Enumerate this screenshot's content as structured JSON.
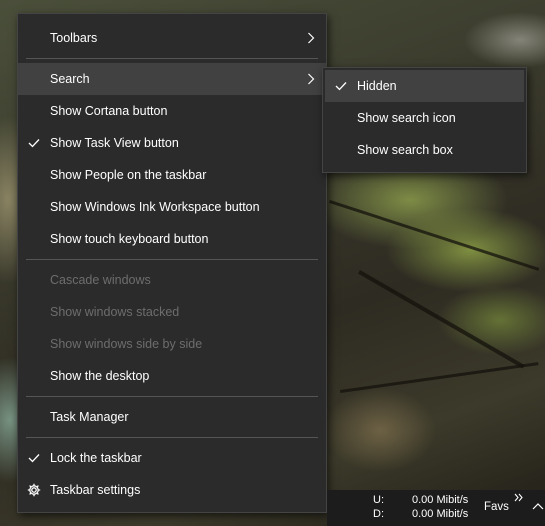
{
  "context_menu": {
    "items": [
      {
        "label": "Toolbars",
        "checked": false,
        "enabled": true,
        "has_submenu": true
      },
      {
        "label": "Search",
        "checked": false,
        "enabled": true,
        "has_submenu": true,
        "highlighted": true
      },
      {
        "label": "Show Cortana button",
        "checked": false,
        "enabled": true
      },
      {
        "label": "Show Task View button",
        "checked": true,
        "enabled": true
      },
      {
        "label": "Show People on the taskbar",
        "checked": false,
        "enabled": true
      },
      {
        "label": "Show Windows Ink Workspace button",
        "checked": false,
        "enabled": true
      },
      {
        "label": "Show touch keyboard button",
        "checked": false,
        "enabled": true
      },
      {
        "label": "Cascade windows",
        "checked": false,
        "enabled": false
      },
      {
        "label": "Show windows stacked",
        "checked": false,
        "enabled": false
      },
      {
        "label": "Show windows side by side",
        "checked": false,
        "enabled": false
      },
      {
        "label": "Show the desktop",
        "checked": false,
        "enabled": true
      },
      {
        "label": "Task Manager",
        "checked": false,
        "enabled": true
      },
      {
        "label": "Lock the taskbar",
        "checked": true,
        "enabled": true
      },
      {
        "label": "Taskbar settings",
        "checked": false,
        "enabled": true,
        "icon": "gear-icon"
      }
    ]
  },
  "search_submenu": {
    "items": [
      {
        "label": "Hidden",
        "checked": true,
        "highlighted": true
      },
      {
        "label": "Show search icon",
        "checked": false
      },
      {
        "label": "Show search box",
        "checked": false
      }
    ]
  },
  "taskbar": {
    "net_upload_label": "U:",
    "net_upload_value": "0.00 Mibit/s",
    "net_download_label": "D:",
    "net_download_value": "0.00 Mibit/s",
    "favs_label": "Favs",
    "overflow_icon": "double-chevron-right-icon",
    "tray_icon": "chevron-up-icon"
  },
  "colors": {
    "menu_bg": "#2b2b2b",
    "menu_highlight": "#414141",
    "menu_text": "#ffffff",
    "menu_disabled_text": "#6d6d6d",
    "separator": "#555555",
    "taskbar_bg": "#1c1c1c"
  }
}
